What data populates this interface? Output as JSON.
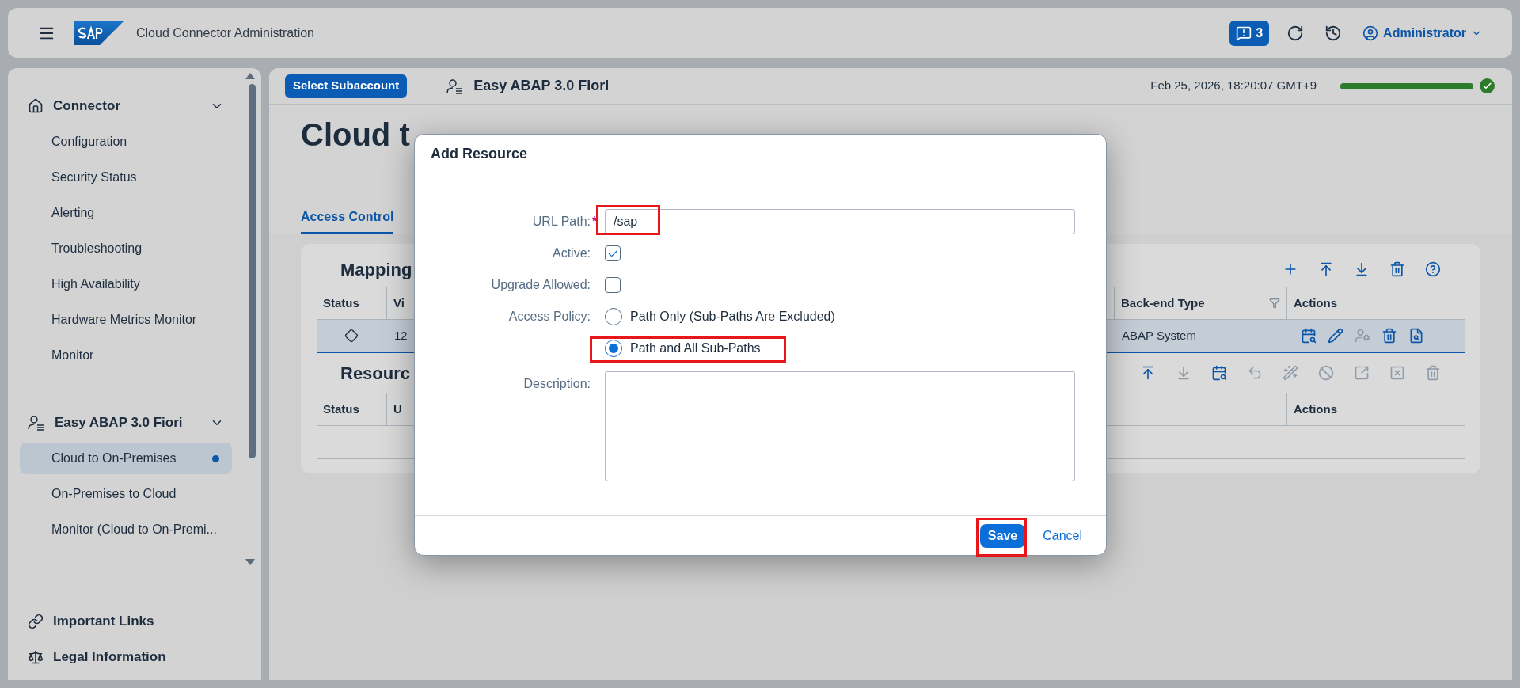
{
  "shell": {
    "title": "Cloud Connector Administration",
    "notifications": "3",
    "user": "Administrator"
  },
  "sidebar": {
    "groups": [
      {
        "kind": "home",
        "label": "Connector",
        "expanded": true,
        "items": [
          {
            "label": "Configuration",
            "selected": false
          },
          {
            "label": "Security Status",
            "selected": false
          },
          {
            "label": "Alerting",
            "selected": false
          },
          {
            "label": "Troubleshooting",
            "selected": false
          },
          {
            "label": "High Availability",
            "selected": false
          },
          {
            "label": "Hardware Metrics Monitor",
            "selected": false
          },
          {
            "label": "Monitor",
            "selected": false
          }
        ]
      },
      {
        "kind": "subaccount",
        "label": "Easy ABAP 3.0 Fiori",
        "expanded": true,
        "items": [
          {
            "label": "Cloud to On-Premises",
            "selected": true
          },
          {
            "label": "On-Premises to Cloud",
            "selected": false
          },
          {
            "label": "Monitor (Cloud to On-Premi...",
            "selected": false
          }
        ]
      }
    ],
    "footer_links": [
      {
        "kind": "link",
        "label": "Important Links"
      },
      {
        "kind": "legal",
        "label": "Legal Information"
      }
    ]
  },
  "subaccount_bar": {
    "button": "Select Subaccount",
    "name": "Easy ABAP 3.0 Fiori",
    "timestamp": "Feb 25, 2026, 18:20:07 GMT+9",
    "level": 1
  },
  "page_title": "Cloud t",
  "tabs": [
    {
      "label": "Access Control",
      "selected": true
    }
  ],
  "mapping": {
    "title": "Mapping",
    "columns": [
      "Status",
      "Vi",
      "Back-end Type",
      "Actions"
    ],
    "rows": [
      {
        "selected": true,
        "cells": [
          "",
          "12",
          "ABAP System"
        ]
      }
    ]
  },
  "resources": {
    "title": "Resourc",
    "columns": [
      "Status",
      "U",
      "Actions"
    ]
  },
  "dialog": {
    "title": "Add Resource",
    "url_path": {
      "label": "URL Path:",
      "required_mark": "*",
      "value": "/sap"
    },
    "active": {
      "label": "Active:",
      "checked": true
    },
    "upgrade_allowed": {
      "label": "Upgrade Allowed:",
      "checked": false
    },
    "access_policy": {
      "label": "Access Policy:",
      "options": [
        {
          "label": "Path Only (Sub-Paths Are Excluded)",
          "selected": false
        },
        {
          "label": "Path and All Sub-Paths",
          "selected": true
        }
      ]
    },
    "description": {
      "label": "Description:"
    },
    "buttons": {
      "save": "Save",
      "cancel": "Cancel"
    }
  }
}
